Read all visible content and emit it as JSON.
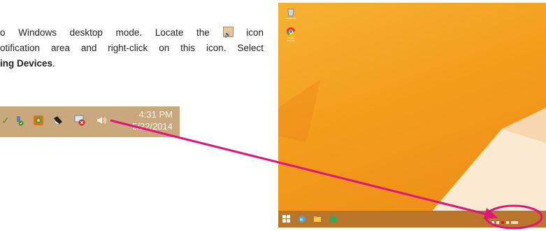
{
  "instructions": {
    "line1_start": "o Windows desktop mode. Locate the",
    "line1_end": "icon",
    "line2": "otification area and right-click on this icon. Select",
    "line3_bold": "ing Devices",
    "line3_end": "."
  },
  "tray": {
    "time": "4:31 PM",
    "date": "5/22/2014",
    "icons": [
      "check-icon",
      "usb-icon",
      "network-icon",
      "speaker-bw-icon",
      "alert-icon",
      "volume-icon"
    ]
  },
  "desktop": {
    "icons": [
      {
        "name": "recycle-bin-icon",
        "label": "Recycle Bin"
      },
      {
        "name": "chrome-icon",
        "label": "Google Chrome"
      }
    ],
    "taskbar_icons": [
      "windows-start-icon",
      "ie-icon",
      "file-explorer-icon",
      "store-icon"
    ]
  },
  "colors": {
    "arrow": "#e0147c",
    "desktop_bg": "#f5a623",
    "tray_bg": "#c8a87c"
  }
}
